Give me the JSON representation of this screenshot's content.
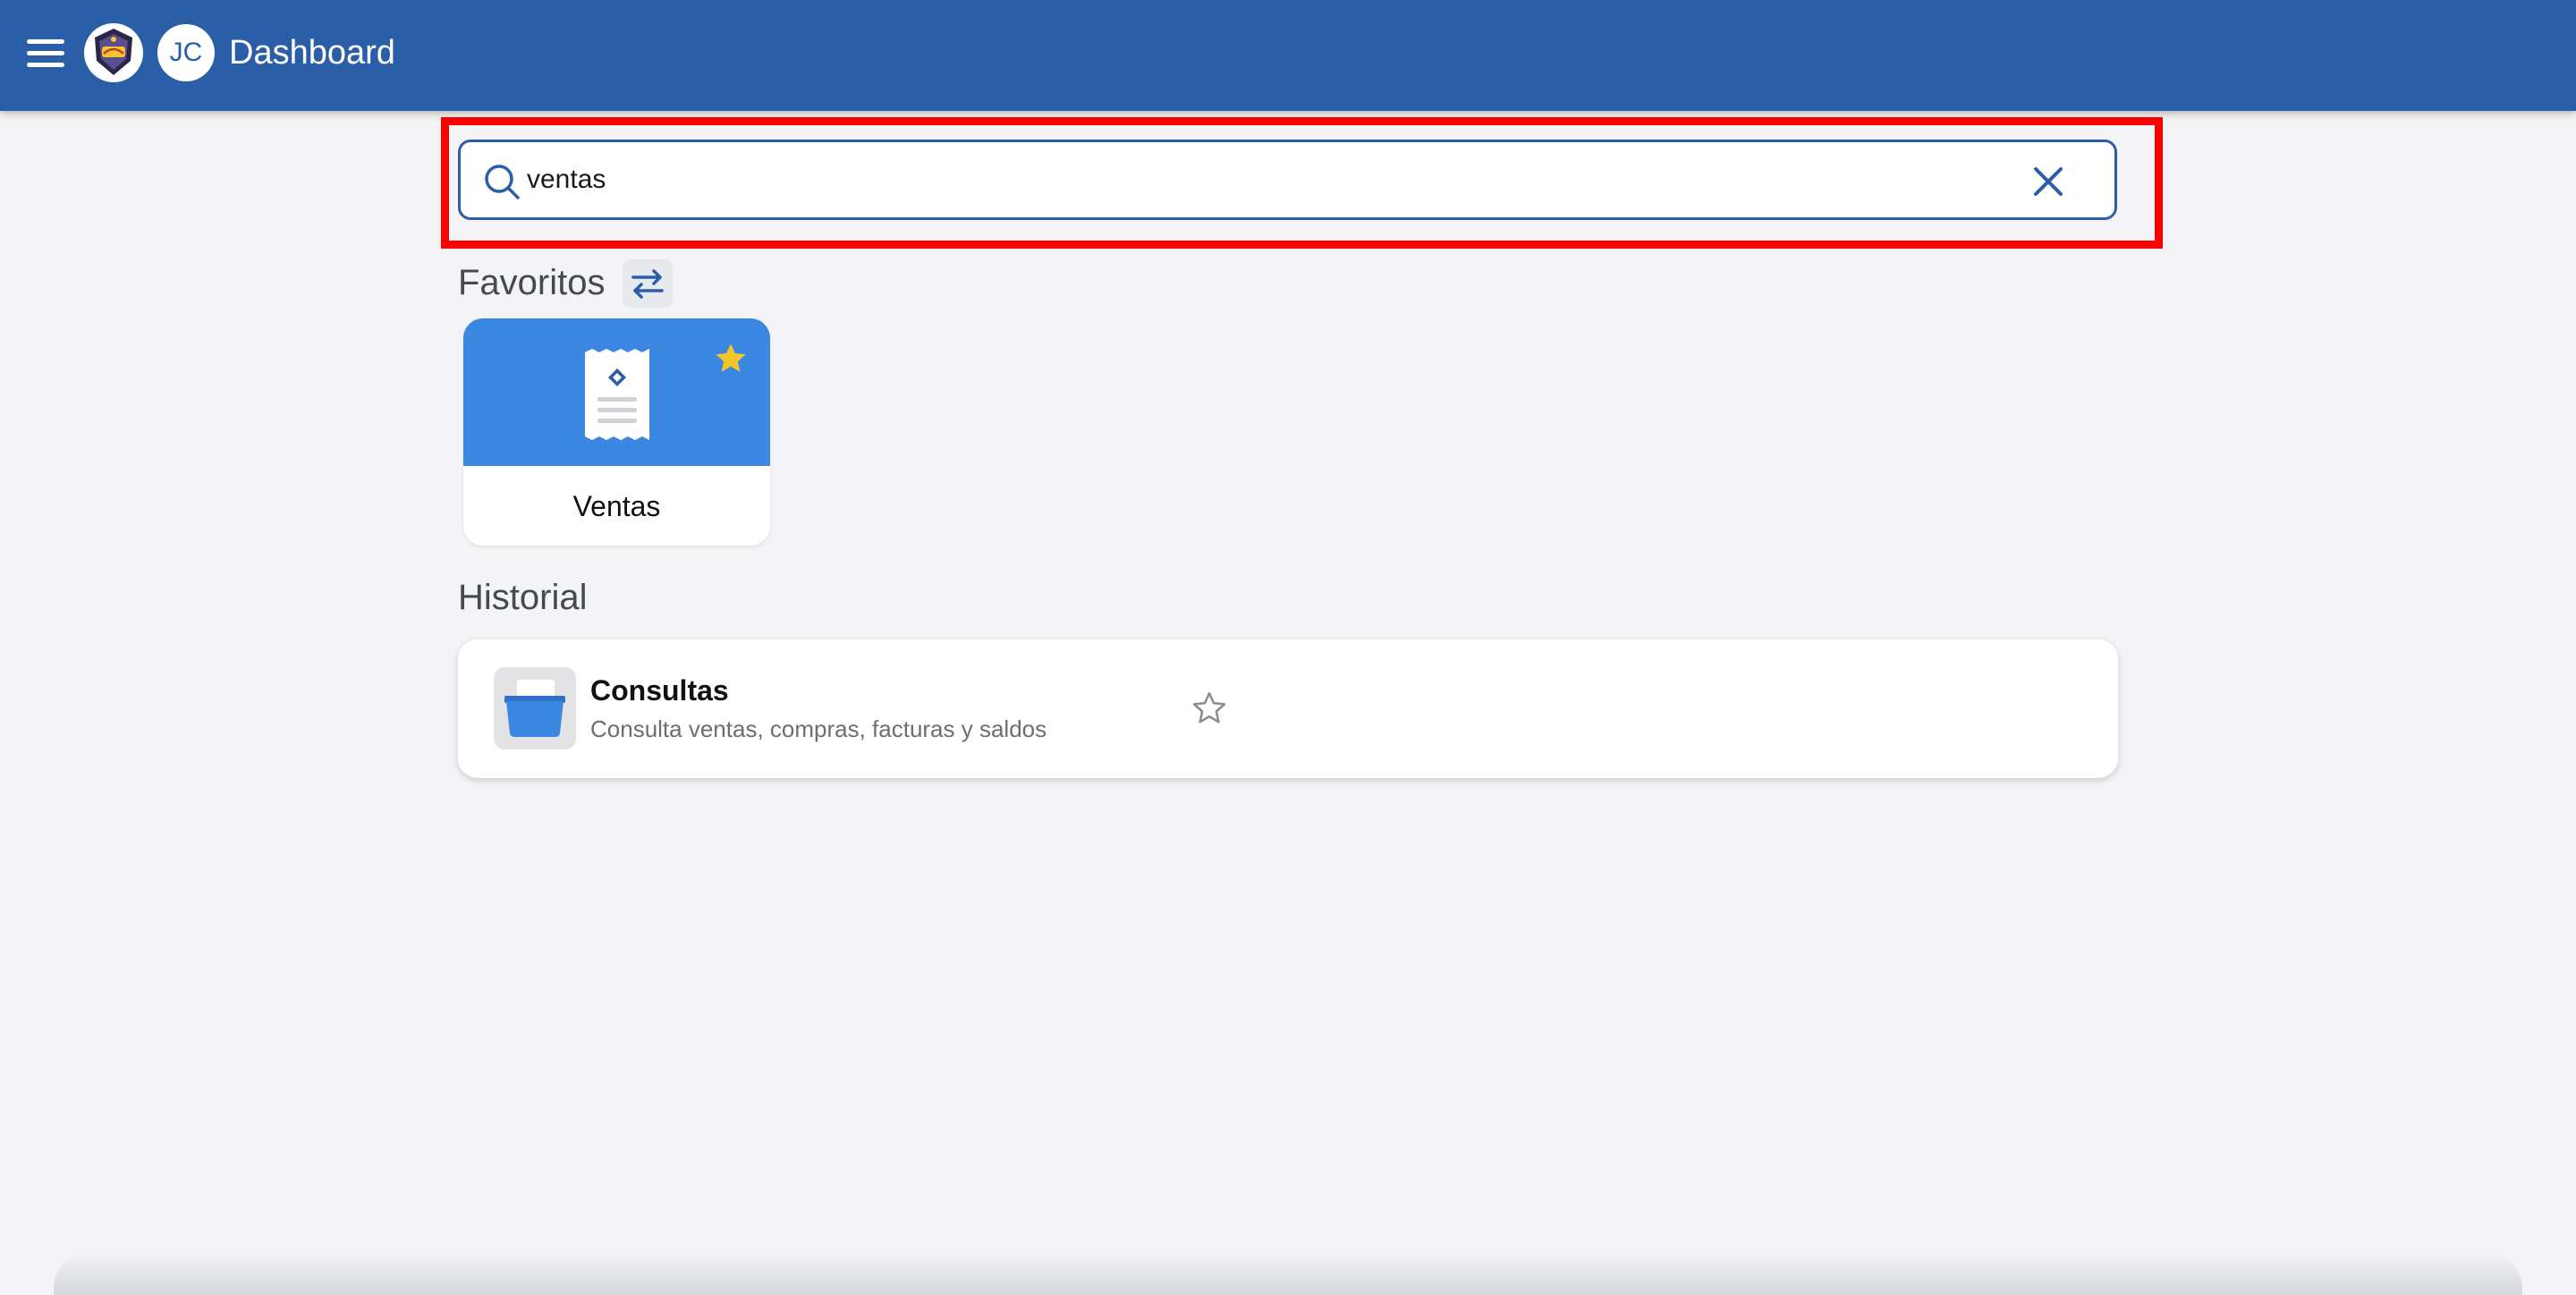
{
  "header": {
    "menu_icon": "hamburger-menu-icon",
    "logo_icon": "super-brand-logo",
    "avatar_initials": "JC",
    "title": "Dashboard",
    "background_color": "#2a5fa8"
  },
  "search": {
    "value": "ventas",
    "search_icon": "search-icon",
    "clear_icon": "close-icon",
    "highlight_color": "#ff0000"
  },
  "favorites": {
    "title": "Favoritos",
    "swap_icon": "swap-arrows-icon",
    "items": [
      {
        "label": "Ventas",
        "icon": "receipt-icon",
        "starred": true,
        "star_color": "#f5c52c",
        "tile_color": "#3b87e2"
      }
    ]
  },
  "history": {
    "title": "Historial",
    "items": [
      {
        "title": "Consultas",
        "description": "Consulta ventas, compras, facturas y saldos",
        "icon": "basket-icon",
        "starred": false
      }
    ]
  }
}
